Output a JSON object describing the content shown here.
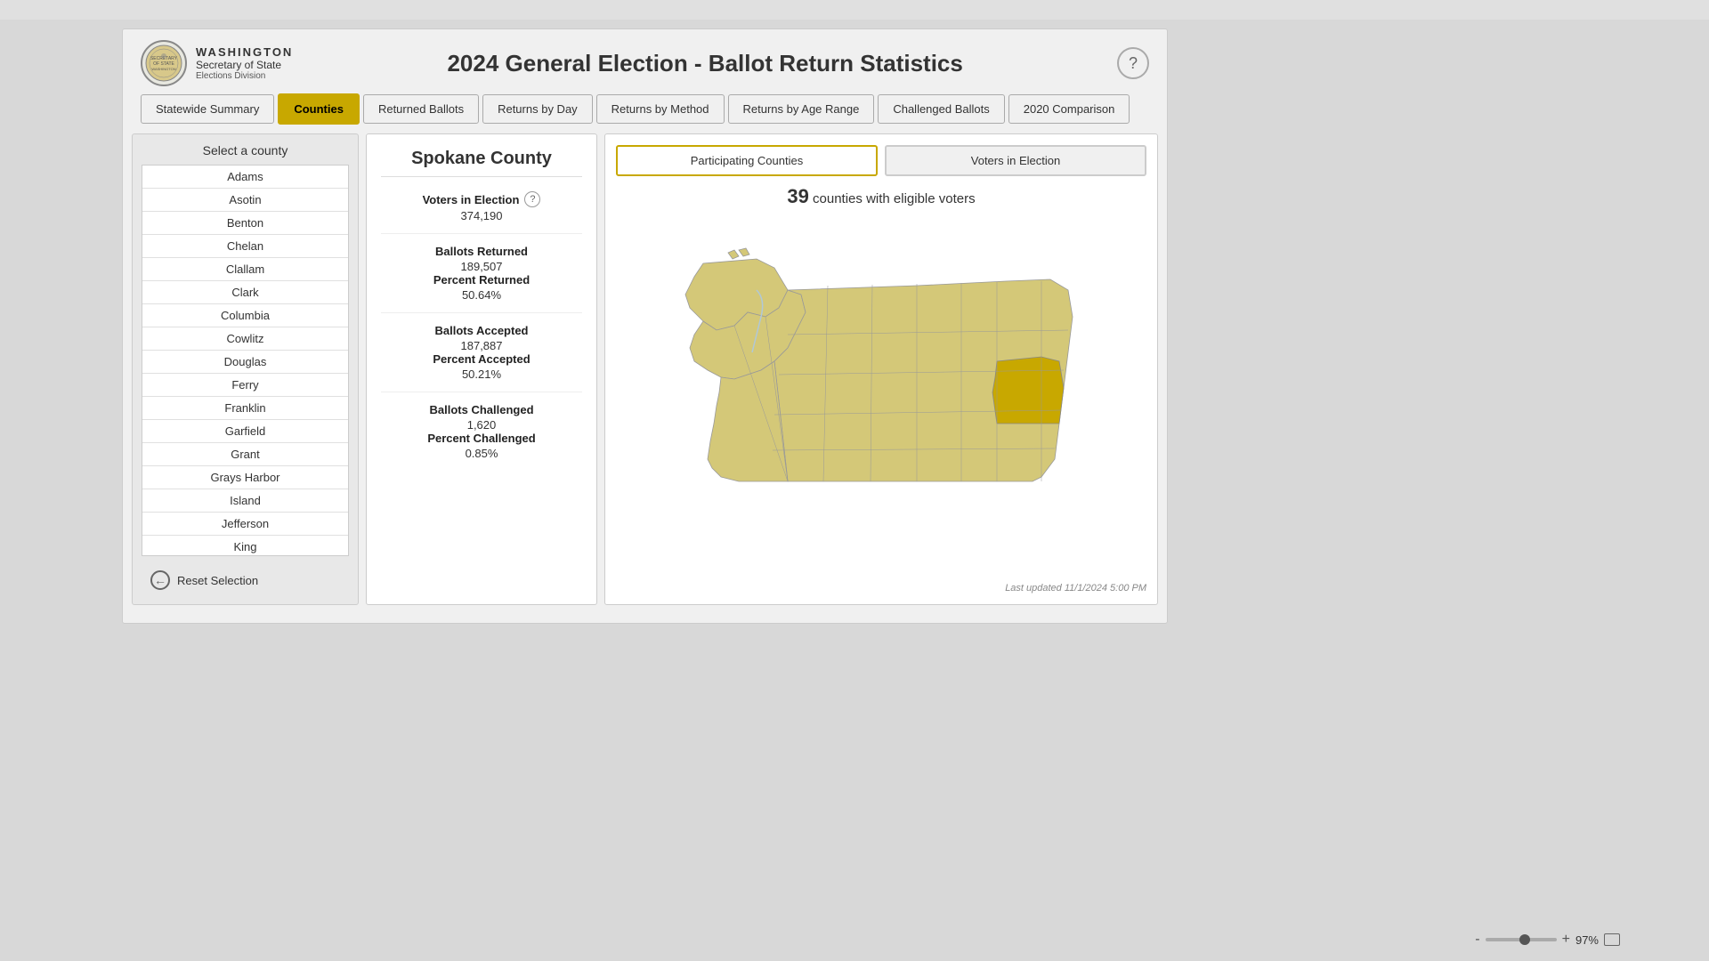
{
  "browser": {
    "title": "2024 General Election - Ballot Return Statistics"
  },
  "header": {
    "org_washington": "WASHINGTON",
    "org_secretary": "Secretary of State",
    "org_division": "Elections Division",
    "page_title": "2024 General Election - Ballot Return Statistics",
    "help_label": "?"
  },
  "tabs": [
    {
      "id": "statewide",
      "label": "Statewide Summary",
      "active": false
    },
    {
      "id": "counties",
      "label": "Counties",
      "active": true
    },
    {
      "id": "returned",
      "label": "Returned Ballots",
      "active": false
    },
    {
      "id": "byday",
      "label": "Returns by Day",
      "active": false
    },
    {
      "id": "bymethod",
      "label": "Returns by Method",
      "active": false
    },
    {
      "id": "byage",
      "label": "Returns by Age Range",
      "active": false
    },
    {
      "id": "challenged",
      "label": "Challenged Ballots",
      "active": false
    },
    {
      "id": "comparison",
      "label": "2020 Comparison",
      "active": false
    }
  ],
  "county_list": {
    "title": "Select a county",
    "counties": [
      "Adams",
      "Asotin",
      "Benton",
      "Chelan",
      "Clallam",
      "Clark",
      "Columbia",
      "Cowlitz",
      "Douglas",
      "Ferry",
      "Franklin",
      "Garfield",
      "Grant",
      "Grays Harbor",
      "Island",
      "Jefferson",
      "King"
    ],
    "selected": "Spokane",
    "reset_label": "Reset Selection"
  },
  "stats": {
    "county_name": "Spokane County",
    "voters_label": "Voters in Election",
    "voters_value": "374,190",
    "returned_label": "Ballots Returned",
    "returned_value": "189,507",
    "pct_returned_label": "Percent Returned",
    "pct_returned_value": "50.64%",
    "accepted_label": "Ballots Accepted",
    "accepted_value": "187,887",
    "pct_accepted_label": "Percent Accepted",
    "pct_accepted_value": "50.21%",
    "challenged_label": "Ballots Challenged",
    "challenged_value": "1,620",
    "pct_challenged_label": "Percent Challenged",
    "pct_challenged_value": "0.85%"
  },
  "map": {
    "tab_participating": "Participating Counties",
    "tab_voters": "Voters in Election",
    "active_tab": "participating",
    "subtitle_count": "39",
    "subtitle_text": "counties with eligible voters",
    "last_updated": "Last updated 11/1/2024 5:00 PM"
  },
  "zoom": {
    "minus": "-",
    "plus": "+",
    "percent": "97%"
  }
}
